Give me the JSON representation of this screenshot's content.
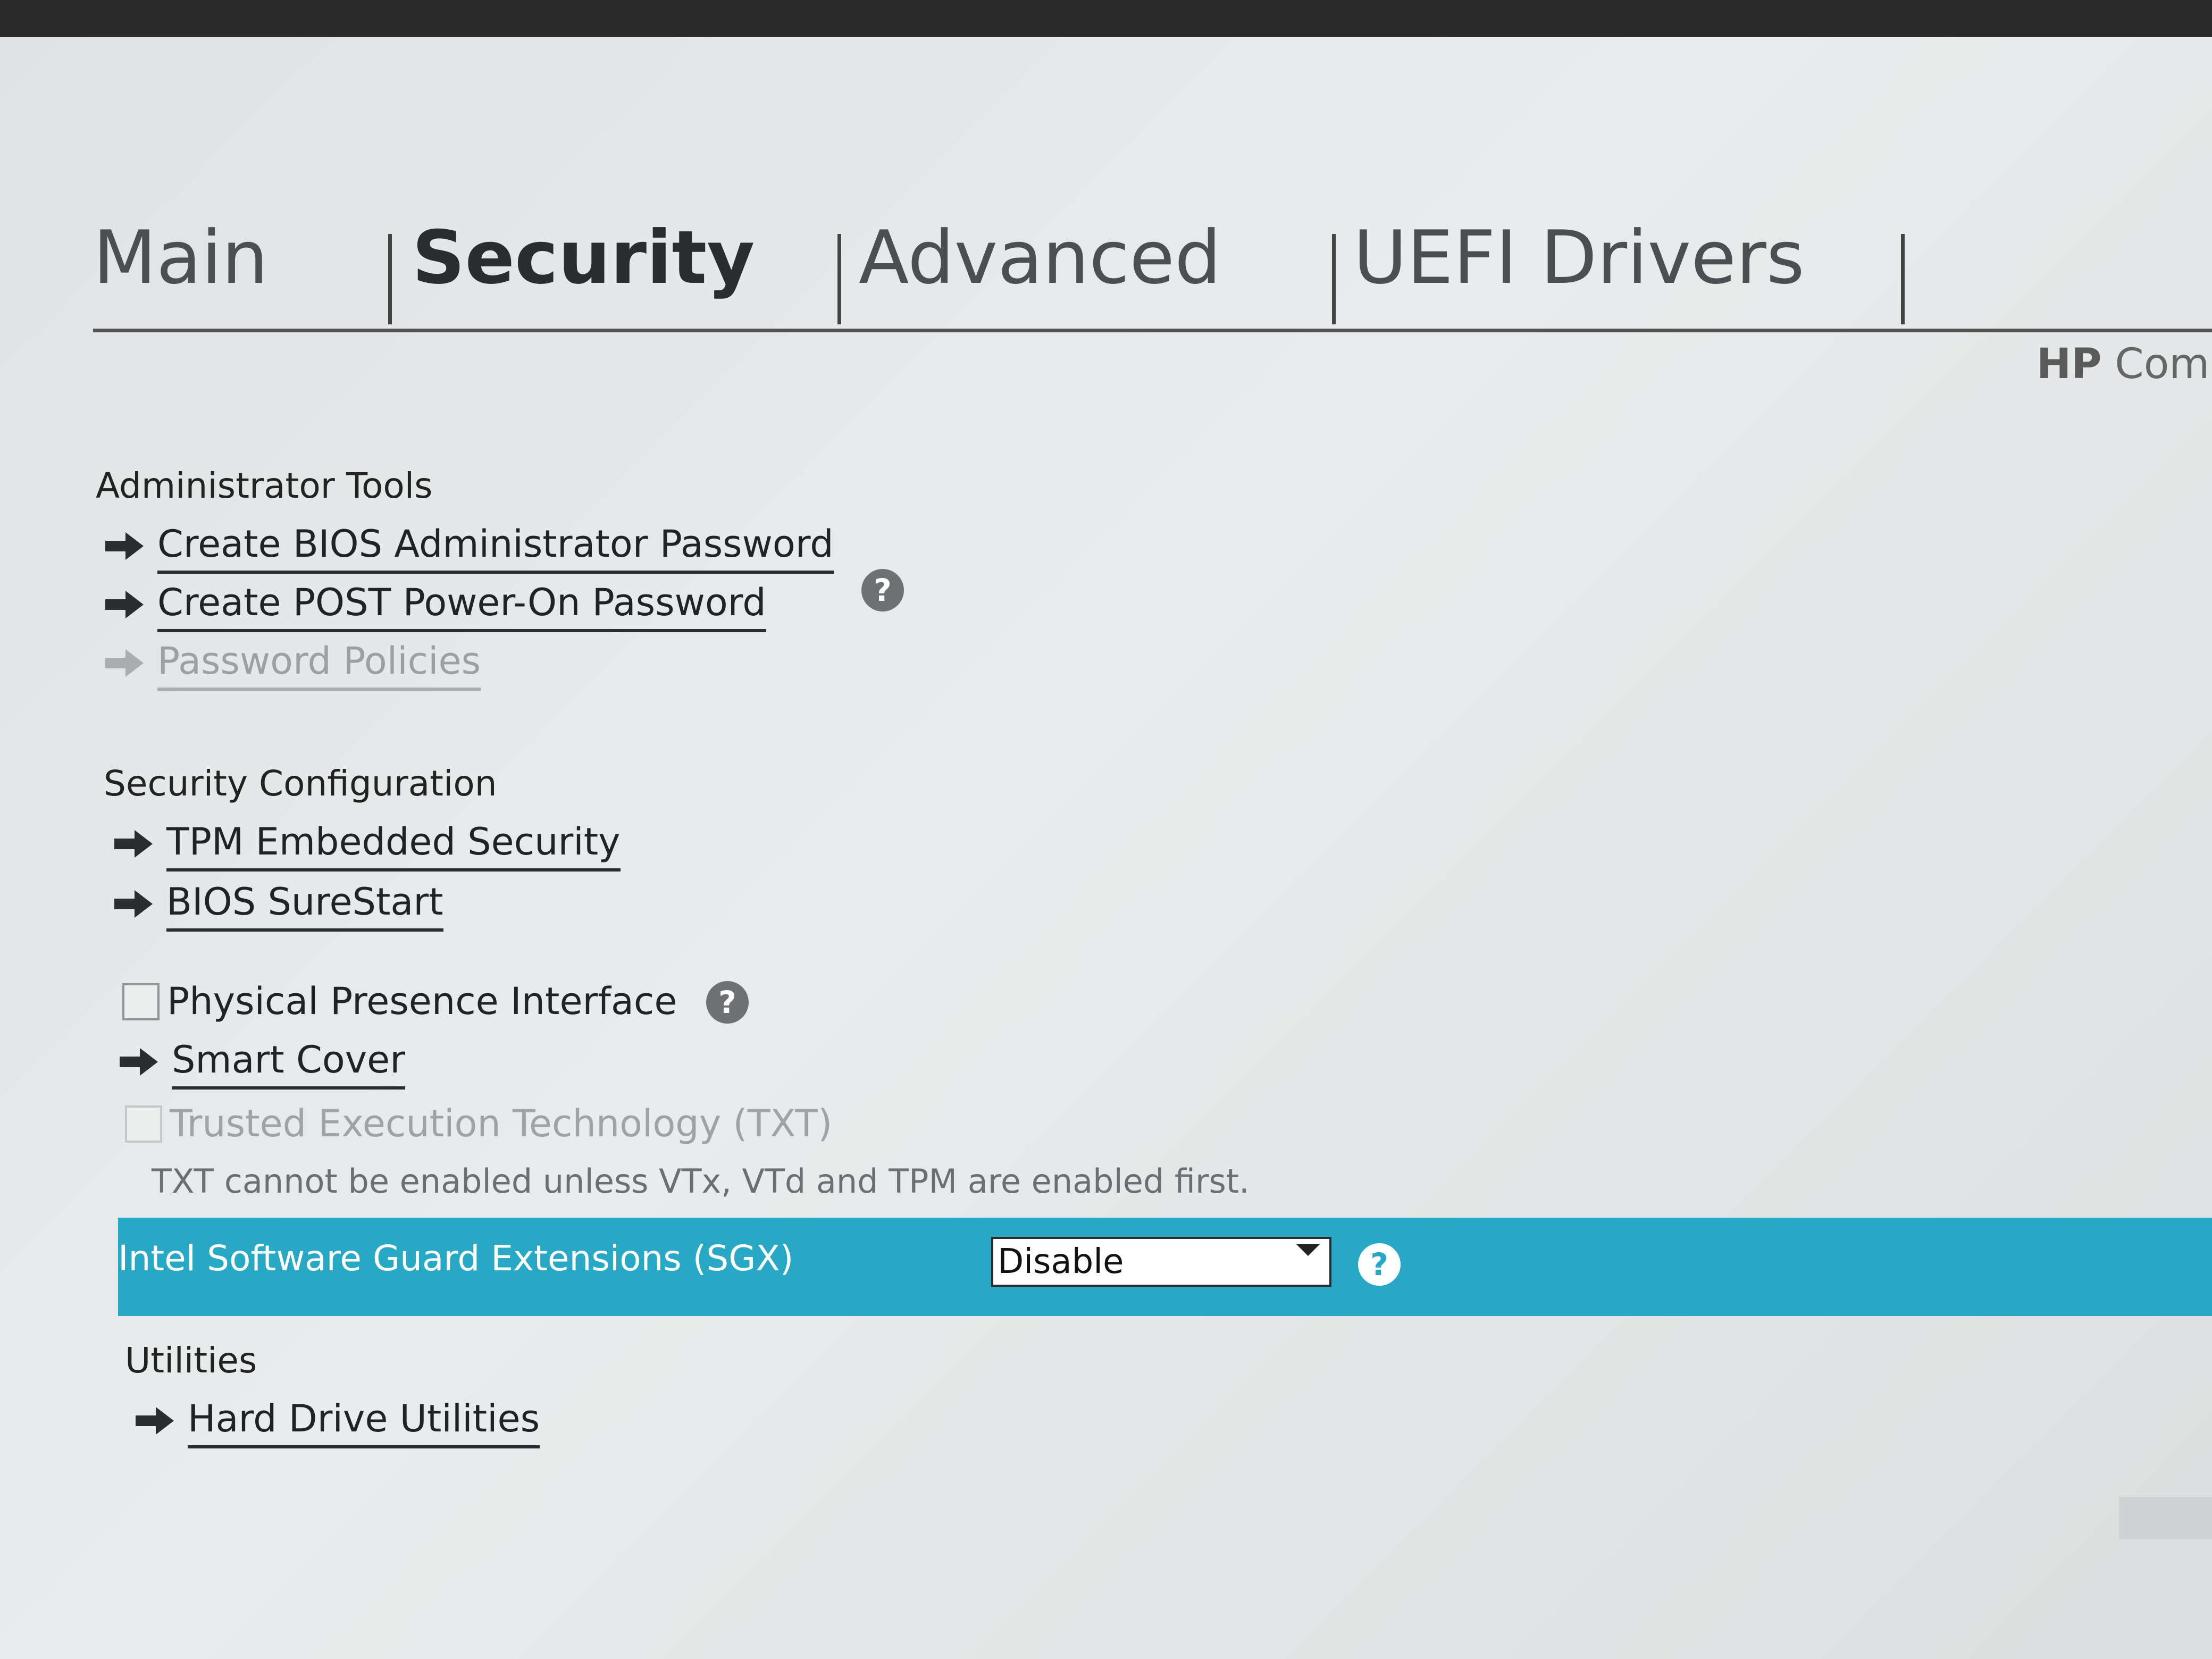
{
  "tabs": [
    {
      "label": "Main",
      "active": false
    },
    {
      "label": "Security",
      "active": true
    },
    {
      "label": "Advanced",
      "active": false
    },
    {
      "label": "UEFI Drivers",
      "active": false
    }
  ],
  "brand": {
    "bold": "HP",
    "rest": "Compu"
  },
  "administrator_tools": {
    "heading": "Administrator Tools",
    "items": [
      {
        "label": "Create BIOS Administrator Password",
        "enabled": true,
        "help": true
      },
      {
        "label": "Create POST Power-On Password",
        "enabled": true,
        "help": false
      },
      {
        "label": "Password Policies",
        "enabled": false,
        "help": false
      }
    ]
  },
  "security_configuration": {
    "heading": "Security Configuration",
    "tpm": "TPM Embedded Security",
    "surestart": "BIOS SureStart",
    "ppi_label": "Physical Presence Interface",
    "ppi_checked": false,
    "smart_cover": "Smart Cover",
    "txt_label": "Trusted Execution Technology (TXT)",
    "txt_checked": false,
    "txt_note": "TXT cannot be enabled unless VTx, VTd and TPM are enabled first.",
    "sgx_label": "Intel Software Guard Extensions (SGX)",
    "sgx_value": "Disable"
  },
  "utilities": {
    "heading": "Utilities",
    "hard_drive": "Hard Drive Utilities"
  },
  "help_glyph": "?",
  "colors": {
    "highlight": "#27a9c6",
    "text": "#1f2326",
    "disabled": "#9aa0a3"
  }
}
